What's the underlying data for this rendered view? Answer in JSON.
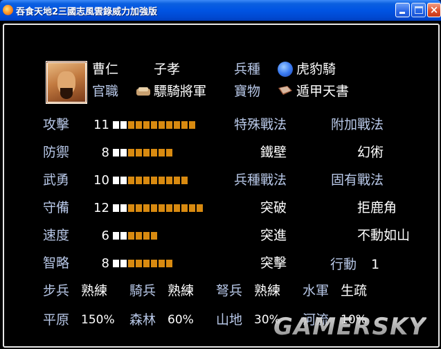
{
  "window": {
    "title": "吞食天地2三國志風雲錄威力加強版",
    "buttons": {
      "minimize": "minimize",
      "maximize": "maximize",
      "close": "×"
    }
  },
  "general": {
    "name": "曹仁",
    "courtesy_name": "子孝",
    "portrait": "portrait-bearded-general",
    "rank_label": "官職",
    "rank_value": "驃騎將軍",
    "troop_label": "兵種",
    "troop_value": "虎豹騎",
    "treasure_label": "寶物",
    "treasure_value": "遁甲天書"
  },
  "stats": [
    {
      "label": "攻擊",
      "value": 11
    },
    {
      "label": "防禦",
      "value": 8
    },
    {
      "label": "武勇",
      "value": 10
    },
    {
      "label": "守備",
      "value": 12
    },
    {
      "label": "速度",
      "value": 6
    },
    {
      "label": "智略",
      "value": 8
    }
  ],
  "tactics": {
    "special_label": "特殊戰法",
    "special_value": "鐵壁",
    "extra_label": "附加戰法",
    "extra_value": "幻術",
    "troop_tactic_label": "兵種戰法",
    "troop_tactics": [
      "突破",
      "突進",
      "突擊"
    ],
    "innate_label": "固有戰法",
    "innate_tactics": [
      "拒鹿角",
      "不動如山"
    ],
    "action_label": "行動",
    "action_value": "1"
  },
  "proficiency": [
    {
      "label": "步兵",
      "value": "熟練"
    },
    {
      "label": "騎兵",
      "value": "熟練"
    },
    {
      "label": "弩兵",
      "value": "熟練"
    },
    {
      "label": "水軍",
      "value": "生疏"
    }
  ],
  "terrain": [
    {
      "label": "平原",
      "value": "150%"
    },
    {
      "label": "森林",
      "value": "60%"
    },
    {
      "label": "山地",
      "value": "30%"
    },
    {
      "label": "河流",
      "value": "10%"
    }
  ],
  "watermark": "GAMERSKY",
  "colors": {
    "label": "#b8c8e8",
    "value": "#ffffff",
    "bar_fill": "#d88a10",
    "bar_base": "#ffffff"
  }
}
